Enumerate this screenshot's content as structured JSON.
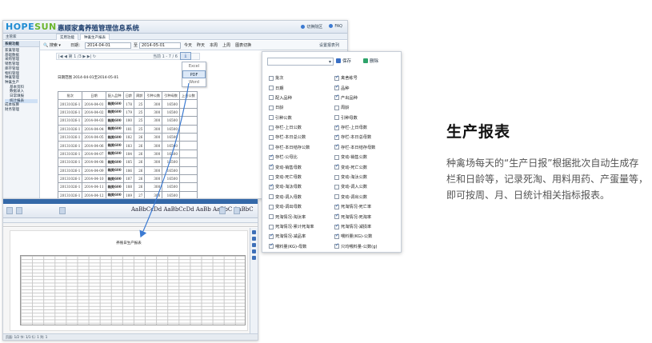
{
  "app": {
    "logo_a": "HOPE",
    "logo_b": "SUN",
    "title": "惠顺家禽养殖管理信息系统",
    "header_links": [
      "切换院区",
      "FAQ"
    ],
    "user": "主管家",
    "tabs": [
      "实用功能",
      "种禽生产报表"
    ],
    "sidebar_title": "系统功能",
    "sidebar_items": [
      {
        "label": "家禽管理",
        "sub": false
      },
      {
        "label": "基础数据",
        "sub": false
      },
      {
        "label": "采购管理",
        "sub": false
      },
      {
        "label": "销售管理",
        "sub": false
      },
      {
        "label": "库存管理",
        "sub": false
      },
      {
        "label": "物料管理",
        "sub": false
      },
      {
        "label": "种禽管理",
        "sub": false
      },
      {
        "label": "种禽生产",
        "sub": false
      },
      {
        "label": "基本资料",
        "sub": true
      },
      {
        "label": "数据录入",
        "sub": true
      },
      {
        "label": "日常填报",
        "sub": true
      },
      {
        "label": "统计报表",
        "sub": true
      },
      {
        "label": "成本核算",
        "sub": false
      },
      {
        "label": "财务管理",
        "sub": false
      }
    ],
    "toolbar": {
      "search": "搜索",
      "date_label": "日期：",
      "date_from": "2014-04-01",
      "date_to_label": "至",
      "date_to": "2014-05-01",
      "quick_links": [
        "今天",
        "昨天",
        "本周",
        "上周",
        "图表切换"
      ],
      "config": "设置报表列"
    },
    "pager": "|◀  ◀  第 1  /3  ▶  ▶|    ↻",
    "pager_right": "当前 1 - 7 / 6",
    "export_label": "导出",
    "export_options": [
      "Excel",
      "PDF",
      "Word"
    ],
    "export_selected": "PDF",
    "report_range": "日期范围 2014-04-01至2014-05-01",
    "table": {
      "headers": [
        "批次",
        "日期",
        "配入品种",
        "日龄",
        "周龄",
        "引种公数",
        "引种母数",
        "上日公数"
      ],
      "rows": [
        [
          "20131026-1",
          "2014-04-01",
          "箱美600",
          "178",
          "25",
          "300",
          "16500",
          ""
        ],
        [
          "20131026-1",
          "2014-04-02",
          "箱美600",
          "179",
          "25",
          "300",
          "16500",
          ""
        ],
        [
          "20131026-1",
          "2014-04-03",
          "箱美600",
          "180",
          "25",
          "300",
          "16500",
          ""
        ],
        [
          "20131026-1",
          "2014-04-04",
          "箱美600",
          "181",
          "25",
          "300",
          "16500",
          ""
        ],
        [
          "20131026-1",
          "2014-04-05",
          "箱美600",
          "182",
          "26",
          "300",
          "16500",
          ""
        ],
        [
          "20131026-1",
          "2014-04-06",
          "箱美600",
          "183",
          "26",
          "300",
          "16500",
          ""
        ],
        [
          "20131026-1",
          "2014-04-07",
          "箱美600",
          "184",
          "26",
          "300",
          "16500",
          ""
        ],
        [
          "20131026-1",
          "2014-04-08",
          "箱美600",
          "185",
          "26",
          "300",
          "16500",
          ""
        ],
        [
          "20131026-1",
          "2014-04-09",
          "箱美600",
          "186",
          "26",
          "300",
          "16500",
          ""
        ],
        [
          "20131026-1",
          "2014-04-10",
          "箱美600",
          "187",
          "26",
          "300",
          "16500",
          ""
        ],
        [
          "20131026-1",
          "2014-04-11",
          "箱美600",
          "188",
          "26",
          "300",
          "16500",
          ""
        ],
        [
          "20131026-1",
          "2014-04-12",
          "箱美600",
          "189",
          "27",
          "300",
          "16500",
          ""
        ]
      ]
    }
  },
  "column_panel": {
    "save": "保存",
    "delete": "删除",
    "columns": [
      {
        "label": "批次",
        "checked": false
      },
      {
        "label": "禽舍栋号",
        "checked": true
      },
      {
        "label": "日期",
        "checked": false
      },
      {
        "label": "品种",
        "checked": true
      },
      {
        "label": "配入品种",
        "checked": false
      },
      {
        "label": "产出品种",
        "checked": true
      },
      {
        "label": "日龄",
        "checked": false
      },
      {
        "label": "周龄",
        "checked": false
      },
      {
        "label": "引种公数",
        "checked": false
      },
      {
        "label": "引种母数",
        "checked": false
      },
      {
        "label": "存栏-上日公数",
        "checked": false
      },
      {
        "label": "存栏-上日母数",
        "checked": true
      },
      {
        "label": "存栏-本日总公数",
        "checked": false
      },
      {
        "label": "存栏-本日总母数",
        "checked": true
      },
      {
        "label": "存栏-本日结存公数",
        "checked": false
      },
      {
        "label": "存栏-本日结存母数",
        "checked": true
      },
      {
        "label": "存栏-公母比",
        "checked": true
      },
      {
        "label": "变动-销售公数",
        "checked": false
      },
      {
        "label": "变动-销售母数",
        "checked": true
      },
      {
        "label": "变动-死亡公数",
        "checked": true
      },
      {
        "label": "变动-死亡母数",
        "checked": false
      },
      {
        "label": "变动-淘汰公数",
        "checked": false
      },
      {
        "label": "变动-淘汰母数",
        "checked": true
      },
      {
        "label": "变动-调入公数",
        "checked": false
      },
      {
        "label": "变动-调入母数",
        "checked": false
      },
      {
        "label": "变动-调出公数",
        "checked": false
      },
      {
        "label": "变动-调出母数",
        "checked": false
      },
      {
        "label": "死淘情况-死亡率",
        "checked": true
      },
      {
        "label": "死淘情况-淘汰率",
        "checked": false
      },
      {
        "label": "死淘情况-死淘率",
        "checked": true
      },
      {
        "label": "死淘情况-累计死淘率",
        "checked": false
      },
      {
        "label": "死淘情况-减损率",
        "checked": true
      },
      {
        "label": "死淘情况-减品率",
        "checked": true
      },
      {
        "label": "喂料量(KG)-公数",
        "checked": true
      },
      {
        "label": "喂料量(KG)-母数",
        "checked": true
      },
      {
        "label": "只均喂料量-公数(g)",
        "checked": true
      }
    ]
  },
  "preview": {
    "ribbon_text": "AaBbCcDd AaBbCcDd AaBb AaBbC AaBbC",
    "heading": "养殖日生产报表",
    "status": "页面: 1/2  节: 1/1  行: 1  列: 1"
  },
  "feature": {
    "title": "生产报表",
    "description": "种禽场每天的“生产日报”根据批次自动生成存栏和日龄等，记录死淘、用料用药、产蛋量等，即可按周、月、日统计相关指标报表。"
  },
  "colors": {
    "logo_blue": "#1f8cd3",
    "logo_green": "#6bb62d",
    "title_navy": "#1e3f6e",
    "accent_blue": "#3b7ad2",
    "arrow_blue": "#3b7ad2",
    "check_blue": "#1c55a8"
  }
}
